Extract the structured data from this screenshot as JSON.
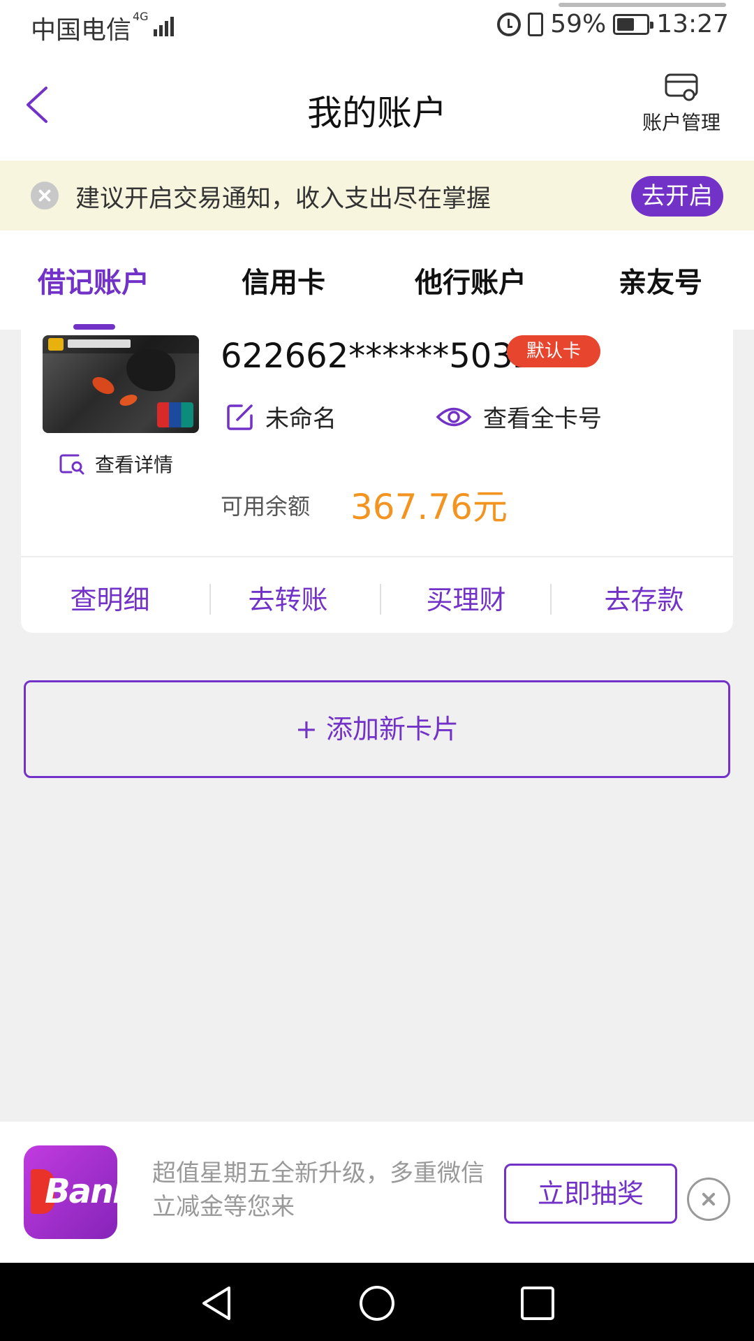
{
  "status_bar": {
    "carrier": "中国电信",
    "network": "4G",
    "battery": "59%",
    "battery_level": 0.59,
    "time": "13:27"
  },
  "nav": {
    "title": "我的账户",
    "manage_label": "账户管理"
  },
  "notice": {
    "text": "建议开启交易通知，收入支出尽在掌握",
    "button": "去开启"
  },
  "tabs": [
    {
      "label": "借记账户",
      "active": true
    },
    {
      "label": "信用卡",
      "active": false
    },
    {
      "label": "他行账户",
      "active": false
    },
    {
      "label": "亲友号",
      "active": false
    }
  ],
  "card": {
    "number": "622662******5032",
    "default_badge": "默认卡",
    "rename_label": "未命名",
    "view_full_label": "查看全卡号",
    "details_label": "查看详情",
    "balance_label": "可用余额",
    "balance_value": "367.76元",
    "actions": [
      "查明细",
      "去转账",
      "买理财",
      "去存款"
    ]
  },
  "add_card": "+ 添加新卡片",
  "promo": {
    "app_icon_text": "Bank",
    "text": "超值星期五全新升级，多重微信立减金等您来",
    "button": "立即抽奖"
  },
  "colors": {
    "accent": "#7232c7",
    "balance": "#f2941f",
    "badge": "#e8452f",
    "notice_bg": "#f7f5de"
  }
}
